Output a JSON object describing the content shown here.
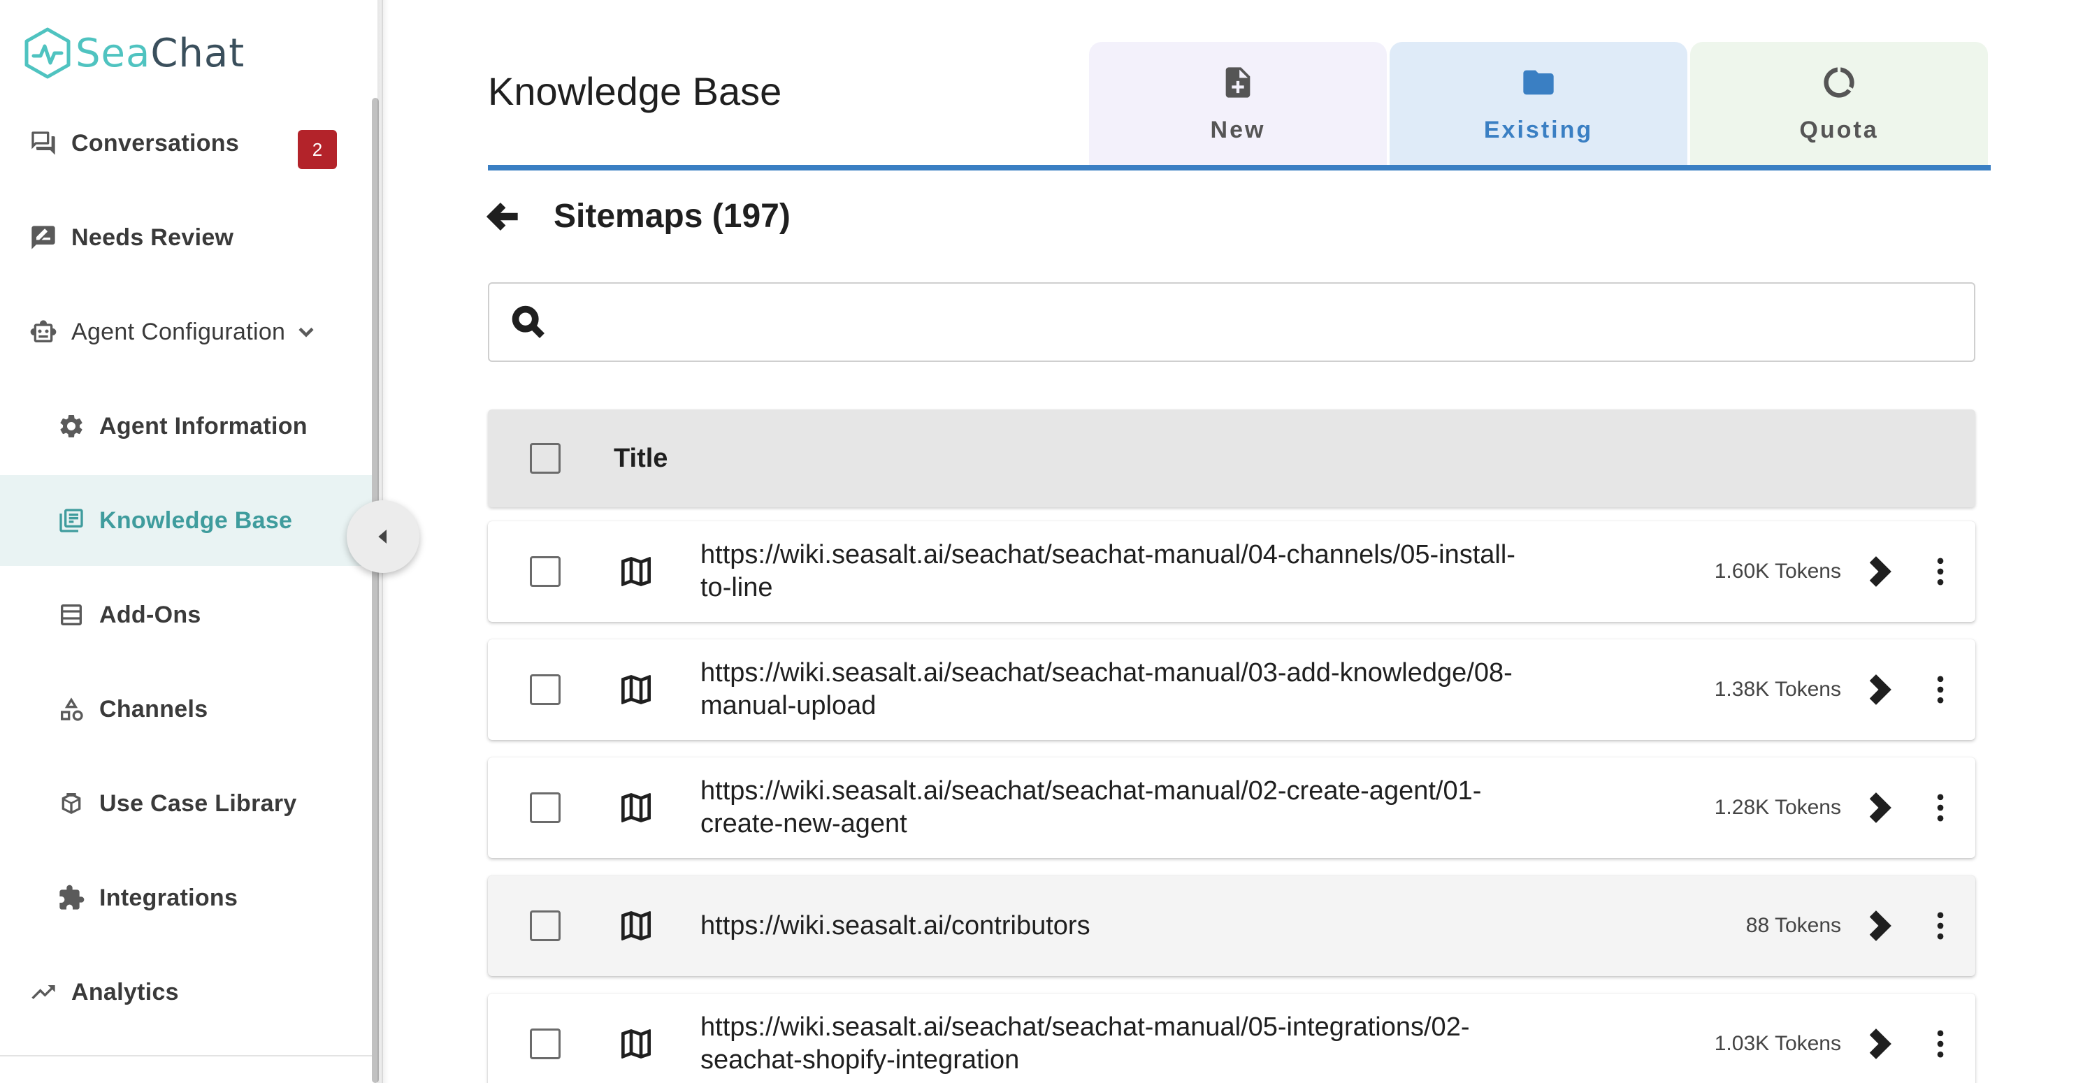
{
  "app": {
    "logo_text_part1": "Sea",
    "logo_text_part2": "Chat",
    "brand_color": "#4fc3c0",
    "accent_color": "#3a7fc3",
    "badge_color": "#b3232a"
  },
  "sidebar": {
    "items": [
      {
        "label": "Conversations",
        "icon": "conversations-icon",
        "badge": "2"
      },
      {
        "label": "Needs Review",
        "icon": "rate-review-icon"
      },
      {
        "label": "Agent Configuration",
        "icon": "robot-icon",
        "expanded": true
      },
      {
        "label": "Agent Information",
        "icon": "gear-icon"
      },
      {
        "label": "Knowledge Base",
        "icon": "library-books-icon",
        "active": true
      },
      {
        "label": "Add-Ons",
        "icon": "list-icon"
      },
      {
        "label": "Channels",
        "icon": "shapes-icon"
      },
      {
        "label": "Use Case Library",
        "icon": "box-icon"
      },
      {
        "label": "Integrations",
        "icon": "puzzle-icon"
      },
      {
        "label": "Analytics",
        "icon": "trending-up-icon"
      }
    ]
  },
  "main": {
    "title": "Knowledge Base",
    "tabs": [
      {
        "label": "New",
        "icon": "note-add-icon"
      },
      {
        "label": "Existing",
        "icon": "folder-icon",
        "active": true
      },
      {
        "label": "Quota",
        "icon": "donut-icon"
      }
    ],
    "section_title": "Sitemaps (197)",
    "search": {
      "value": "",
      "placeholder": ""
    },
    "table": {
      "columns": [
        "Title"
      ],
      "rows": [
        {
          "title": "https://wiki.seasalt.ai/seachat/seachat-manual/04-channels/05-install-to-line",
          "tokens": "1.60K Tokens"
        },
        {
          "title": "https://wiki.seasalt.ai/seachat/seachat-manual/03-add-knowledge/08-manual-upload",
          "tokens": "1.38K Tokens"
        },
        {
          "title": "https://wiki.seasalt.ai/seachat/seachat-manual/02-create-agent/01-create-new-agent",
          "tokens": "1.28K Tokens"
        },
        {
          "title": "https://wiki.seasalt.ai/contributors",
          "tokens": "88 Tokens"
        },
        {
          "title": "https://wiki.seasalt.ai/seachat/seachat-manual/05-integrations/02-seachat-shopify-integration",
          "tokens": "1.03K Tokens"
        }
      ]
    }
  }
}
